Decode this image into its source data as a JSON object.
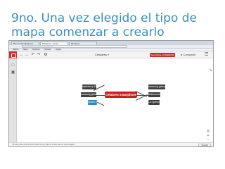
{
  "slide": {
    "title_line1": "9no. Una vez elegido el tipo de",
    "title_line2": "mapa comenzar a crearlo"
  },
  "browser": {
    "tabs": [
      "Bienvenido Mindomo",
      "Mindomo - Crear",
      "Mindomo"
    ],
    "url": "www.mindomo.com/es/mindmap/",
    "bookmarks": [
      "Galeria",
      "Sitios",
      "Mindomo",
      "Noticias",
      "Ayuda"
    ]
  },
  "app": {
    "map_title": "Celulares",
    "subscribe_label": "Suscribirse al PREMIUM",
    "share_label": "Compartir",
    "status_text": "Sonido: pulse click derecho sobre tema y elija un sonido para el tema elegido",
    "status_button": "Guardar"
  },
  "mind_map": {
    "central": "Celulares smartphone",
    "left_nodes": [
      "blackberry Z10",
      "samsung galaxy S3",
      "iphone 5S"
    ],
    "right_nodes": [
      "samsung galaxy s4",
      "Nokia lumia",
      "LG optimus"
    ],
    "selected_node": "iphone 5S"
  },
  "icons": {
    "back": "back-arrow-icon",
    "forward": "forward-arrow-icon",
    "undo": "undo-icon",
    "redo": "redo-icon",
    "settings": "gear-icon",
    "menu": "hamburger-menu-icon"
  },
  "colors": {
    "title": "#3a8fb7",
    "central_node": "#c61f1f",
    "node": "#3f3f3f",
    "selected_node": "#2f86c4",
    "subscribe": "#c3302b"
  }
}
